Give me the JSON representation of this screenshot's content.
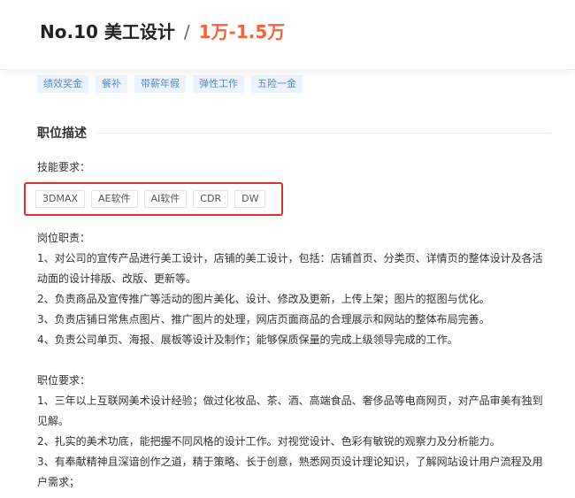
{
  "header": {
    "job_title": "No.10 美工设计",
    "separator": "/",
    "salary": "1万-1.5万"
  },
  "benefits": [
    "绩效奖金",
    "餐补",
    "带薪年假",
    "弹性工作",
    "五险一金"
  ],
  "section": {
    "title": "职位描述"
  },
  "skills": {
    "label": "技能要求：",
    "items": [
      "3DMAX",
      "AE软件",
      "AI软件",
      "CDR",
      "DW"
    ]
  },
  "duties": {
    "title": "岗位职责：",
    "items": [
      "1、对公司的宣传产品进行美工设计，店铺的美工设计，包括：店铺首页、分类页、详情页的整体设计及各活动面的设计排版、改版、更新等。",
      "2、负责商品及宣传推广等活动的图片美化、设计、修改及更新，上传上架；图片的抠图与优化。",
      "3、负责店铺日常焦点图片、推广图片的处理，网店页面商品的合理展示和网站的整体布局完善。",
      "4、负责公司单页、海报、展板等设计及制作；能够保质保量的完成上级领导完成的工作。"
    ]
  },
  "requirements": {
    "title": "职位要求：",
    "items": [
      "1、三年以上互联网美术设计经验；做过化妆品、茶、酒、高端食品、奢侈品等电商网页，对产品审美有独到见解。",
      "2、扎实的美术功底，能把握不同风格的设计工作。对视觉设计、色彩有敏锐的观察力及分析能力。",
      "3、有奉献精神且深谙创作之道，精于策略、长于创意，熟悉网页设计理论知识，了解网站设计用户流程及用户需求；"
    ]
  }
}
